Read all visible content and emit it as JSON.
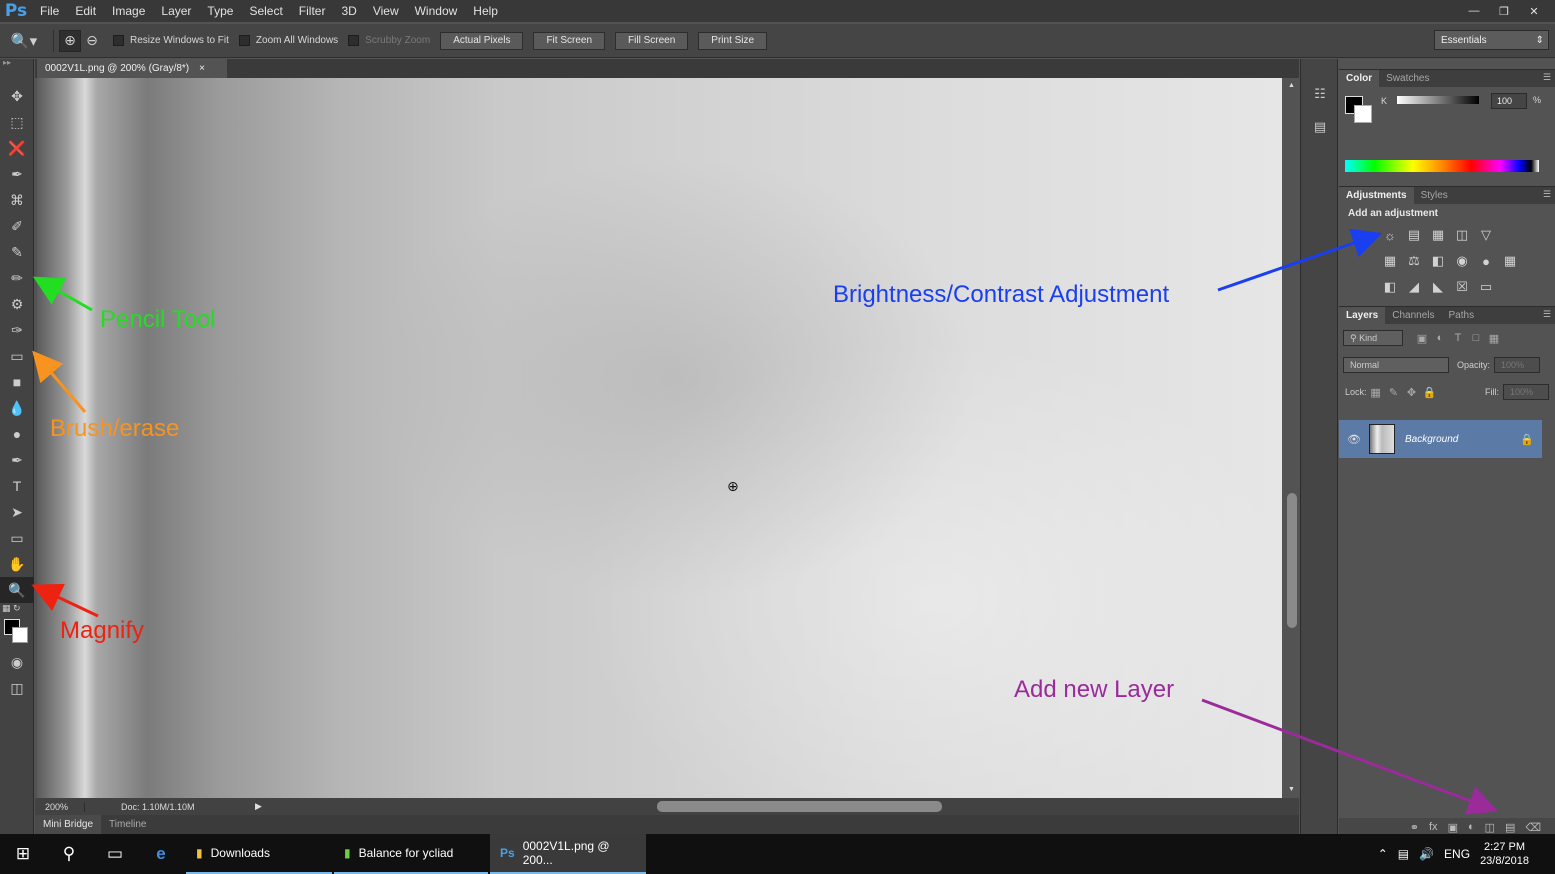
{
  "app": {
    "logo": "Ps",
    "menu": [
      "File",
      "Edit",
      "Image",
      "Layer",
      "Type",
      "Select",
      "Filter",
      "3D",
      "View",
      "Window",
      "Help"
    ],
    "window_controls": [
      "—",
      "❐",
      "✕"
    ]
  },
  "options_bar": {
    "checkbox_resize": "Resize Windows to Fit",
    "checkbox_zoom_all": "Zoom All Windows",
    "checkbox_scrubby": "Scrubby Zoom",
    "btn_actual_pixels": "Actual Pixels",
    "btn_fit_screen": "Fit Screen",
    "btn_fill_screen": "Fill Screen",
    "btn_print_size": "Print Size",
    "workspace": "Essentials"
  },
  "document": {
    "tab_title": "0002V1L.png @ 200% (Gray/8*)",
    "zoom": "200%",
    "doc_size": "Doc: 1.10M/1.10M"
  },
  "bottom_tabs": [
    "Mini Bridge",
    "Timeline"
  ],
  "color_panel": {
    "tabs": [
      "Color",
      "Swatches"
    ],
    "channel": "K",
    "value": "100",
    "unit": "%"
  },
  "adjustments_panel": {
    "tabs": [
      "Adjustments",
      "Styles"
    ],
    "title": "Add an adjustment"
  },
  "layers_panel": {
    "tabs": [
      "Layers",
      "Channels",
      "Paths"
    ],
    "filter": "Kind",
    "blend_mode": "Normal",
    "opacity_label": "Opacity:",
    "opacity_value": "100%",
    "lock_label": "Lock:",
    "fill_label": "Fill:",
    "fill_value": "100%",
    "layer_name": "Background"
  },
  "annotations": {
    "pencil": "Pencil Tool",
    "brush": "Brush/erase",
    "magnify": "Magnify",
    "brightness": "Brightness/Contrast Adjustment",
    "new_layer": "Add new Layer",
    "colors": {
      "pencil": "#22dd22",
      "brush": "#f7931e",
      "magnify": "#ee2211",
      "brightness": "#1a3ff0",
      "new_layer": "#9b2a9b"
    }
  },
  "taskbar": {
    "apps": [
      "Downloads",
      "Balance for ycliad",
      "0002V1L.png @ 200..."
    ],
    "lang": "ENG",
    "time": "2:27 PM",
    "date": "23/8/2018"
  }
}
